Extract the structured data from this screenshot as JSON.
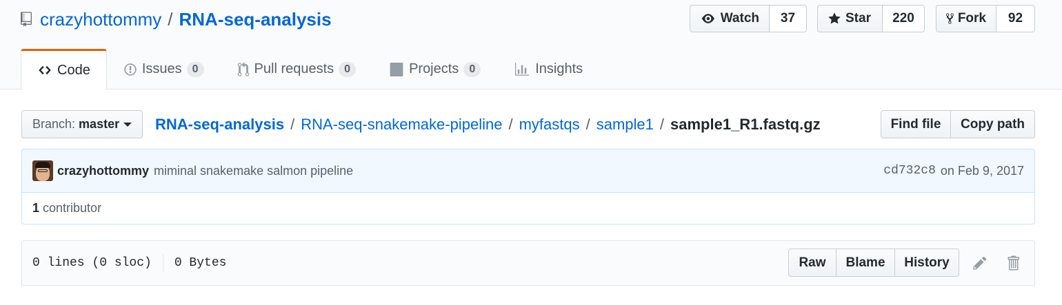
{
  "repo": {
    "owner": "crazyhottommy",
    "separator": "/",
    "name": "RNA-seq-analysis"
  },
  "social": {
    "watch": {
      "label": "Watch",
      "count": "37"
    },
    "star": {
      "label": "Star",
      "count": "220"
    },
    "fork": {
      "label": "Fork",
      "count": "92"
    }
  },
  "tabs": [
    {
      "label": "Code",
      "count": null
    },
    {
      "label": "Issues",
      "count": "0"
    },
    {
      "label": "Pull requests",
      "count": "0"
    },
    {
      "label": "Projects",
      "count": "0"
    },
    {
      "label": "Insights",
      "count": null
    }
  ],
  "branch": {
    "prefix": "Branch:",
    "name": "master"
  },
  "breadcrumb": {
    "items": [
      "RNA-seq-analysis",
      "RNA-seq-snakemake-pipeline",
      "myfastqs",
      "sample1"
    ],
    "separator": "/",
    "final": "sample1_R1.fastq.gz"
  },
  "file_actions": {
    "find_file": "Find file",
    "copy_path": "Copy path"
  },
  "commit": {
    "author": "crazyhottommy",
    "message": "miminal snakemake salmon pipeline",
    "sha": "cd732c8",
    "date": "on Feb 9, 2017"
  },
  "contributors": {
    "count": "1",
    "label": "contributor"
  },
  "file": {
    "lines": "0 lines (0 sloc)",
    "size": "0 Bytes",
    "raw": "Raw",
    "blame": "Blame",
    "history": "History"
  },
  "icons": {
    "repo": "repo-icon",
    "watch": "eye-icon",
    "star": "star-icon",
    "fork": "fork-icon",
    "code": "code-icon",
    "issues": "issue-icon",
    "pulls": "git-pull-request-icon",
    "projects": "project-icon",
    "insights": "graph-icon",
    "edit": "pencil-icon",
    "delete": "trashcan-icon"
  },
  "colors": {
    "link": "#0366d6",
    "selected_tab_accent": "#e36209",
    "commit_bg": "#f1f8ff"
  }
}
